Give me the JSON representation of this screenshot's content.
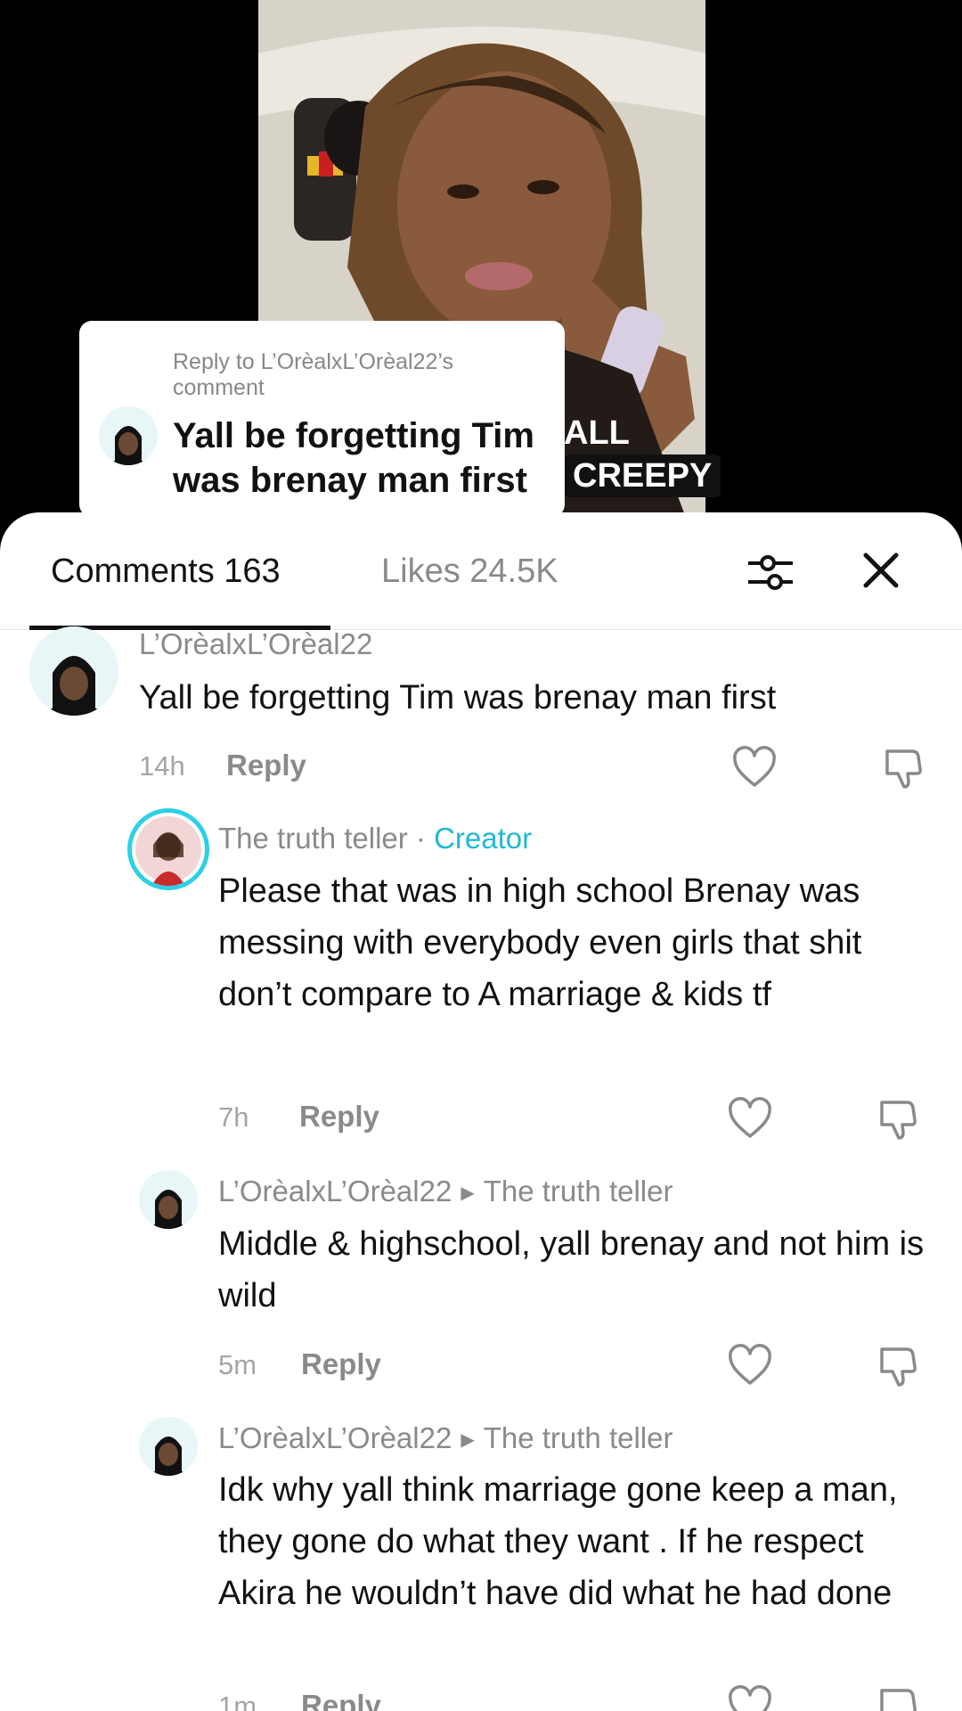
{
  "reply_card": {
    "reply_to": "Reply to L’OrèalxL’Orèal22’s comment",
    "body": "Yall be forgetting Tim was brenay man first"
  },
  "video_overlay": {
    "line1": "ALL",
    "line2": "CREEPY"
  },
  "tabs": {
    "comments": "Comments 163",
    "likes": "Likes 24.5K"
  },
  "comments": [
    {
      "username": "L’OrèalxL’Orèal22",
      "text": "Yall be forgetting Tim was brenay man first",
      "time": "14h",
      "reply": "Reply"
    },
    {
      "username": "The truth teller",
      "separator": " · ",
      "creator_label": "Creator",
      "text": "Please that was in high school Brenay was messing with everybody even girls that shit don’t compare to A marriage & kids tf",
      "time": "7h",
      "reply": "Reply"
    },
    {
      "username": "L’OrèalxL’Orèal22",
      "reply_to": "The truth teller",
      "text": "Middle & highschool, yall brenay and not him is wild",
      "time": "5m",
      "reply": "Reply"
    },
    {
      "username": "L’OrèalxL’Orèal22",
      "reply_to": "The truth teller",
      "text": "Idk why yall think marriage gone keep a man, they gone do what they want . If he respect Akira he wouldn’t have did what he had done",
      "time": "1m",
      "reply": "Reply"
    }
  ],
  "icons": {
    "like": "heart-icon",
    "dislike": "thumbs-down-icon",
    "filter": "sliders-icon",
    "close": "close-icon"
  }
}
